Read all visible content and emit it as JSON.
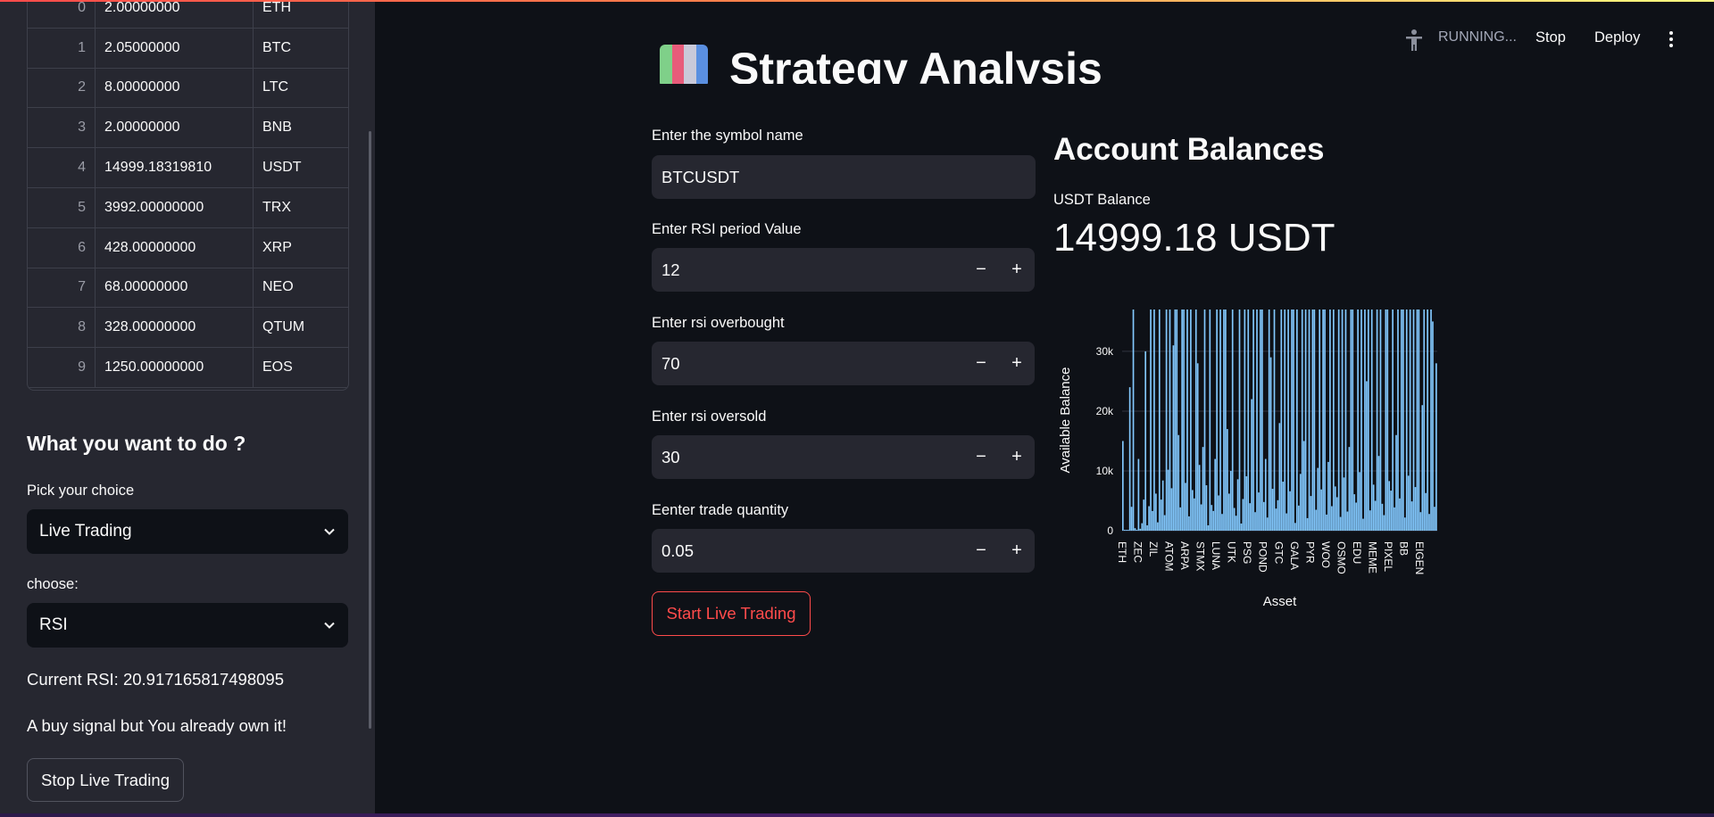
{
  "header": {
    "running": "RUNNING...",
    "stop": "Stop",
    "deploy": "Deploy"
  },
  "page": {
    "title": "Strategy Analysis"
  },
  "balances_table": {
    "rows": [
      {
        "idx": "0",
        "free": "2.00000000",
        "asset": "ETH"
      },
      {
        "idx": "1",
        "free": "2.05000000",
        "asset": "BTC"
      },
      {
        "idx": "2",
        "free": "8.00000000",
        "asset": "LTC"
      },
      {
        "idx": "3",
        "free": "2.00000000",
        "asset": "BNB"
      },
      {
        "idx": "4",
        "free": "14999.18319810",
        "asset": "USDT"
      },
      {
        "idx": "5",
        "free": "3992.00000000",
        "asset": "TRX"
      },
      {
        "idx": "6",
        "free": "428.00000000",
        "asset": "XRP"
      },
      {
        "idx": "7",
        "free": "68.00000000",
        "asset": "NEO"
      },
      {
        "idx": "8",
        "free": "328.00000000",
        "asset": "QTUM"
      },
      {
        "idx": "9",
        "free": "1250.00000000",
        "asset": "EOS"
      }
    ]
  },
  "sidebar": {
    "heading": "What you want to do ?",
    "pick_label": "Pick your choice",
    "pick_value": "Live Trading",
    "choose_label": "choose:",
    "choose_value": "RSI",
    "current_rsi": "Current RSI: 20.917165817498095",
    "signal": "A buy signal but You already own it!",
    "stop_button": "Stop Live Trading"
  },
  "form": {
    "symbol_label": "Enter the symbol name",
    "symbol_value": "BTCUSDT",
    "rsi_period_label": "Enter RSI period Value",
    "rsi_period_value": "12",
    "overbought_label": "Enter rsi overbought",
    "overbought_value": "70",
    "oversold_label": "Enter rsi oversold",
    "oversold_value": "30",
    "quantity_label": "Eenter trade quantity",
    "quantity_value": "0.05",
    "minus": "−",
    "plus": "+",
    "start_button": "Start Live Trading"
  },
  "account": {
    "title": "Account Balances",
    "usdt_label": "USDT Balance",
    "usdt_value": "14999.18 USDT"
  },
  "colors": {
    "bar": "#83c9ff",
    "accent": "#ff4b4b"
  },
  "chart_data": {
    "type": "bar",
    "xlabel": "Asset",
    "ylabel": "Available Balance",
    "ylim": [
      0,
      37000
    ],
    "yticks": [
      0,
      10000,
      20000,
      30000
    ],
    "ytick_labels": [
      "0",
      "10k",
      "20k",
      "30k"
    ],
    "visible_x_labels": [
      "ETH",
      "ZEC",
      "ZIL",
      "ATOM",
      "ARPA",
      "STMX",
      "LUNA",
      "UTK",
      "PSG",
      "POND",
      "GTC",
      "GALA",
      "PYR",
      "WOO",
      "OSMO",
      "EDU",
      "MEME",
      "PIXEL",
      "BB",
      "EIGEN"
    ],
    "values": [
      15000,
      2,
      8,
      2,
      24000,
      3992,
      37000,
      428,
      68,
      12000,
      328,
      1250,
      5200,
      30000,
      900,
      4100,
      37000,
      3300,
      37000,
      6200,
      1400,
      37000,
      5200,
      8400,
      2600,
      37000,
      10200,
      37000,
      7100,
      31000,
      37000,
      37000,
      16000,
      3900,
      37000,
      37000,
      8000,
      37000,
      2400,
      37000,
      6800,
      5400,
      37000,
      28000,
      11000,
      4400,
      14000,
      37000,
      7600,
      900,
      37000,
      4300,
      3300,
      12000,
      37000,
      5900,
      37000,
      2800,
      37000,
      37000,
      17000,
      6200,
      10000,
      37000,
      3800,
      2500,
      8600,
      37000,
      1200,
      5300,
      37000,
      9100,
      37000,
      4600,
      22000,
      37000,
      3100,
      37000,
      6400,
      37000,
      37000,
      4800,
      12000,
      2200,
      37000,
      29000,
      7000,
      37000,
      3700,
      5100,
      18000,
      37000,
      8200,
      37000,
      2900,
      37000,
      6600,
      37000,
      37000,
      1300,
      37000,
      4200,
      9500,
      37000,
      15000,
      37000,
      2100,
      37000,
      5800,
      37000,
      37000,
      3500,
      10500,
      37000,
      6900,
      37000,
      37000,
      2700,
      11500,
      37000,
      4100,
      37000,
      7400,
      5600,
      37000,
      2300,
      37000,
      8900,
      37000,
      3200,
      14000,
      37000,
      37000,
      6100,
      4700,
      37000,
      9800,
      37000,
      2000,
      37000,
      25000,
      37000,
      3400,
      37000,
      7700,
      5000,
      37000,
      12500,
      37000,
      4500,
      2600,
      37000,
      37000,
      8300,
      6700,
      37000,
      3900,
      16000,
      37000,
      5400,
      37000,
      37000,
      2200,
      37000,
      9200,
      37000,
      4900,
      37000,
      7300,
      37000,
      37000,
      3100,
      21000,
      37000,
      6300,
      37000,
      2800,
      37000,
      35000,
      4000,
      28000
    ]
  }
}
